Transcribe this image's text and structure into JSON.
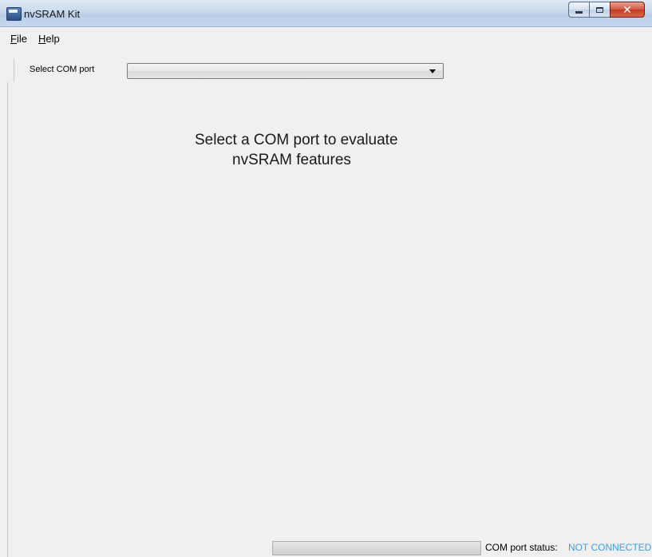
{
  "window": {
    "title": "nvSRAM Kit",
    "app_icon": "nvsram-app-icon",
    "controls": {
      "minimize_icon": "minimize-icon",
      "maximize_icon": "maximize-icon",
      "close_icon": "close-icon",
      "close_glyph": "✕"
    }
  },
  "menu": {
    "items": [
      {
        "label": "File",
        "accelerator": "F"
      },
      {
        "label": "Help",
        "accelerator": "H"
      }
    ]
  },
  "toolbar": {
    "com_port_label": "Select COM port",
    "com_port_value": ""
  },
  "main": {
    "message_line1": "Select a COM port to evaluate",
    "message_line2": "nvSRAM features"
  },
  "status": {
    "label": "COM port status:",
    "value": "NOT CONNECTED",
    "value_color": "#3aa0e6"
  }
}
